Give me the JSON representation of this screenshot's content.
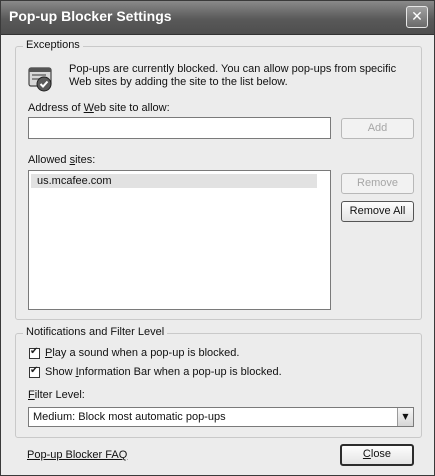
{
  "window": {
    "title": "Pop-up Blocker Settings",
    "close_glyph": "✕"
  },
  "exceptions": {
    "legend": "Exceptions",
    "info_text": "Pop-ups are currently blocked.  You can allow pop-ups from specific Web sites by adding the site to the list below.",
    "icon": "popup-blocker-shield-icon",
    "address_label_pre": "Address of ",
    "address_label_acc": "W",
    "address_label_post": "eb site to allow:",
    "address_value": "",
    "add_button": "Add",
    "allowed_label_pre": "Allowed ",
    "allowed_label_acc": "s",
    "allowed_label_post": "ites:",
    "allowed_sites": [
      "us.mcafee.com"
    ],
    "remove_button": "Remove",
    "remove_all_button": "Remove All"
  },
  "notifications": {
    "legend": "Notifications and Filter Level",
    "play_sound_acc": "P",
    "play_sound_rest": "lay a sound when a pop-up is blocked.",
    "play_sound_checked": true,
    "info_bar_pre": "Show ",
    "info_bar_acc": "I",
    "info_bar_post": "nformation Bar when a pop-up is blocked.",
    "info_bar_checked": true,
    "filter_label_pre": "",
    "filter_label_acc": "F",
    "filter_label_post": "ilter Level:",
    "filter_selected": "Medium: Block most automatic pop-ups"
  },
  "footer": {
    "faq_link": "Pop-up Blocker FAQ",
    "close_button_acc": "C",
    "close_button_rest": "lose"
  }
}
